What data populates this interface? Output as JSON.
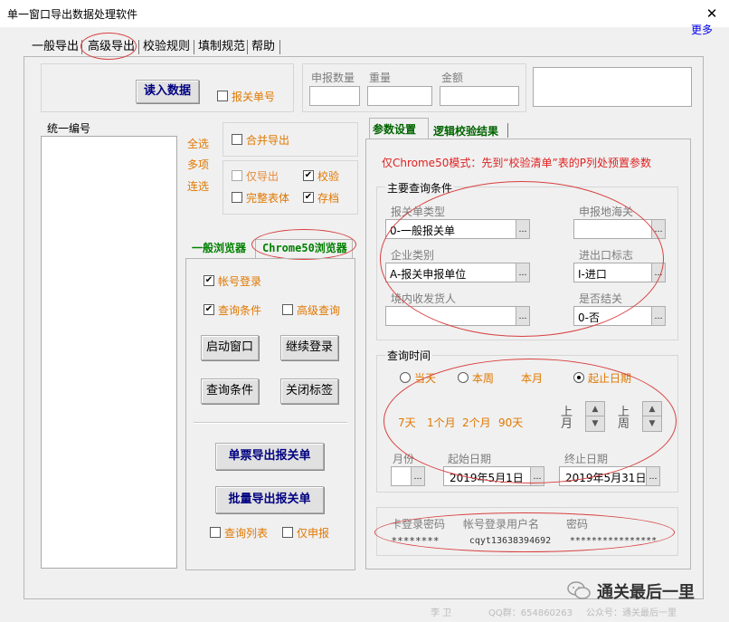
{
  "window": {
    "title": "单一窗口导出数据处理软件",
    "close_glyph": "✕",
    "more_link": "更多"
  },
  "menu_tabs": [
    "一般导出",
    "高级导出",
    "校验规则",
    "填制规范",
    "帮助"
  ],
  "left": {
    "read_button": "读入数据",
    "declaration_no_label": "报关单号",
    "summary_labels": [
      "申报数量",
      "重量",
      "金额"
    ],
    "unified_no_label": "统一编号",
    "select_all": "全选",
    "multi_select": "多项",
    "continuous_select": "连选",
    "merge_export": "合并导出",
    "export_only": "仅导出",
    "verify": "校验",
    "full_body": "完整表体",
    "archive": "存档"
  },
  "browser": {
    "tab_general": "一般浏览器",
    "tab_chrome": "Chrome50浏览器",
    "account_login": "帐号登录",
    "query_conditions_cb": "查询条件",
    "advanced_query": "高级查询",
    "start_window": "启动窗口",
    "continue_login": "继续登录",
    "query_conditions_btn": "查询条件",
    "close_tab": "关闭标签",
    "single_export": "单票导出报关单",
    "batch_export": "批量导出报关单",
    "query_list": "查询列表",
    "declare_only": "仅申报"
  },
  "right": {
    "tab_params": "参数设置",
    "tab_logic": "逻辑校验结果",
    "notice": "仅Chrome50模式：先到“校验清单”表的P列处预置参数",
    "main_query_title": "主要查询条件",
    "decl_type_label": "报关单类型",
    "decl_type_value": "0-一般报关单",
    "customs_label": "申报地海关",
    "customs_value": "",
    "company_type_label": "企业类别",
    "company_type_value": "A-报关申报单位",
    "ie_flag_label": "进出口标志",
    "ie_flag_value": "I-进口",
    "consignee_label": "境内收发货人",
    "consignee_value": "",
    "closed_label": "是否结关",
    "closed_value": "0-否",
    "combo_glyph": "…",
    "query_time_title": "查询时间",
    "radio_today": "当天",
    "radio_week": "本周",
    "radio_month": "本月",
    "radio_range": "起止日期",
    "quick_ranges": [
      "7天",
      "1个月",
      "2个月",
      "90天"
    ],
    "prev_month": "上月",
    "prev_week": "上周",
    "month_label": "月份",
    "start_date_label": "起始日期",
    "start_date_value": "2019年5月1日",
    "end_date_label": "终止日期",
    "end_date_value": "2019年5月31日",
    "card_pwd_label": "卡登录密码",
    "card_pwd_value": "********",
    "account_user_label": "帐号登录用户名",
    "account_user_value": "cqyt13638394692",
    "password_label": "密码",
    "password_value": "****************"
  },
  "watermarks": {
    "bottom_center": "QQ群：654860263",
    "bottom_right": "公众号：通关最后一里",
    "brand": "通关最后一里",
    "left_mark": "李  卫"
  }
}
